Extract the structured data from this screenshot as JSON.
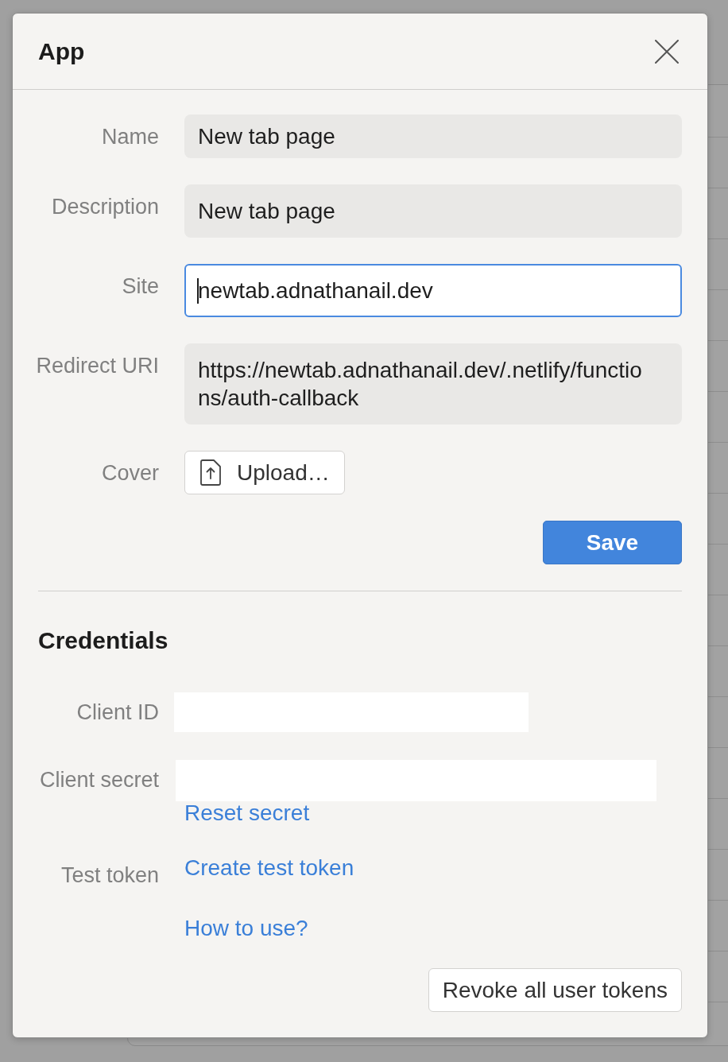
{
  "dialog": {
    "title": "App"
  },
  "form": {
    "fields": [
      {
        "kind": "input",
        "label": "Name",
        "value": "New tab page",
        "focused": false
      },
      {
        "kind": "textarea",
        "label": "Description",
        "value": "New tab page",
        "focused": false
      },
      {
        "kind": "textarea",
        "label": "Site",
        "value": "newtab.adnathanail.dev",
        "focused": true
      },
      {
        "kind": "textarea",
        "label": "Redirect URI",
        "value": "https://newtab.adnathanail.dev/.netlify/functions/auth-callback",
        "focused": false
      },
      {
        "kind": "upload",
        "label": "Cover",
        "button": "Upload…"
      }
    ],
    "save_button": "Save"
  },
  "credentials": {
    "title": "Credentials",
    "rows": [
      {
        "kind": "id",
        "label": "Client ID"
      },
      {
        "kind": "secret",
        "label": "Client secret",
        "links": [
          "Reset secret"
        ]
      },
      {
        "kind": "links",
        "label": "Test token",
        "links": [
          "Create test token",
          "How to use?"
        ]
      }
    ],
    "revoke_button": "Revoke all user tokens"
  }
}
